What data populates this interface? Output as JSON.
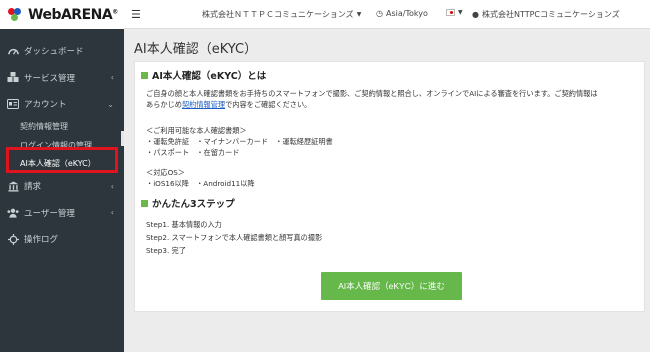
{
  "logo": {
    "text": "WebARENA",
    "mark": "®"
  },
  "sidebar": {
    "items": [
      {
        "label": "ダッシュボード",
        "icon": "dashboard-icon"
      },
      {
        "label": "サービス管理",
        "icon": "services-icon",
        "chevron": "‹"
      },
      {
        "label": "アカウント",
        "icon": "account-card-icon",
        "chevron": "⌄"
      },
      {
        "label": "請求",
        "icon": "bank-icon",
        "chevron": "‹"
      },
      {
        "label": "ユーザー管理",
        "icon": "users-icon",
        "chevron": "‹"
      },
      {
        "label": "操作ログ",
        "icon": "crosshair-icon"
      }
    ],
    "subitems": [
      {
        "label": "契約情報管理"
      },
      {
        "label": "ログイン情報の管理"
      },
      {
        "label": "AI本人確認（eKYC）",
        "active": true
      }
    ]
  },
  "topbar": {
    "org_select": "株式会社ＮＴＴＰＣコミュニケーションズ",
    "timezone": "Asia/Tokyo",
    "language_flag": "🇯🇵",
    "user": "株式会社NTTPCコミュニケーションズ"
  },
  "page": {
    "title": "AI本人確認（eKYC）"
  },
  "section1": {
    "heading": "AI本人確認（eKYC）とは",
    "desc1": "ご自身の顔と本人確認書類をお手持ちのスマートフォンで撮影、ご契約情報と照合し、オンラインでAIによる審査を行います。ご契約情報は",
    "desc2_pre": "あらかじめ",
    "desc2_link": "契約情報管理",
    "desc2_post": "で内容をご確認ください。",
    "docs_title": "＜ご利用可能な本人確認書類＞",
    "docs1": "・運転免許証　・マイナンバーカード　・運転経歴証明書",
    "docs2": "・パスポート　・在留カード",
    "os_title": "＜対応OS＞",
    "os1": "・iOS16以降　・Android11以降"
  },
  "section2": {
    "heading": "かんたん3ステップ",
    "step1": "Step1. 基本情報の入力",
    "step2": "Step2. スマートフォンで本人確認書類と顔写真の撮影",
    "step3": "Step3. 完了"
  },
  "cta": {
    "label": "AI本人確認（eKYC）に進む"
  },
  "colors": {
    "sidebar": "#2d363c",
    "accent": "#66b84b",
    "highlight": "#e1141e",
    "link": "#1a5bc4"
  }
}
